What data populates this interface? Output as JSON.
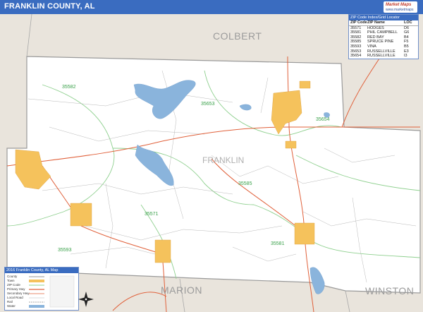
{
  "title": "FRANKLIN COUNTY, AL",
  "logo": {
    "brand": "Market Maps",
    "sub": "www.marketmaps"
  },
  "neighbors": [
    "COLBERT",
    "MARION",
    "WINSTON"
  ],
  "county_name": "FRANKLIN",
  "zip_labels": [
    {
      "code": "35582"
    },
    {
      "code": "35653"
    },
    {
      "code": "35654"
    },
    {
      "code": "35585"
    },
    {
      "code": "35571"
    },
    {
      "code": "35581"
    },
    {
      "code": "35593"
    }
  ],
  "zip_table": {
    "title": "ZIP Code Index/Grid Locator",
    "headers": [
      "ZIP Code",
      "ZIP Name",
      "LOC"
    ],
    "rows": [
      [
        "35571",
        "HODGES",
        "D6"
      ],
      [
        "35581",
        "PHIL CAMPBELL",
        "G6"
      ],
      [
        "35582",
        "RED BAY",
        "B4"
      ],
      [
        "35585",
        "SPRUCE PINE",
        "F5"
      ],
      [
        "35593",
        "VINA",
        "B5"
      ],
      [
        "35653",
        "RUSSELLVILLE",
        "E3"
      ],
      [
        "35654",
        "RUSSELLVILLE",
        "I3"
      ]
    ]
  },
  "legend": {
    "title": "2016 Franklin County, AL Map",
    "items": [
      "County",
      "Town",
      "ZIP Code",
      "Primary Hwy",
      "Secondary Hwy",
      "Local Road",
      "Rail",
      "Water"
    ]
  },
  "colors": {
    "title_bar": "#3a6cc0",
    "county_fill": "#ffffff",
    "outside_fill": "#e9e4dc",
    "town_fill": "#f5c25c",
    "water": "#8ab4dc",
    "primary_road": "#e0603a",
    "zip_boundary": "#8fd08f",
    "local_road": "#b8b8b8"
  },
  "icons": [
    "north-arrow-icon"
  ]
}
